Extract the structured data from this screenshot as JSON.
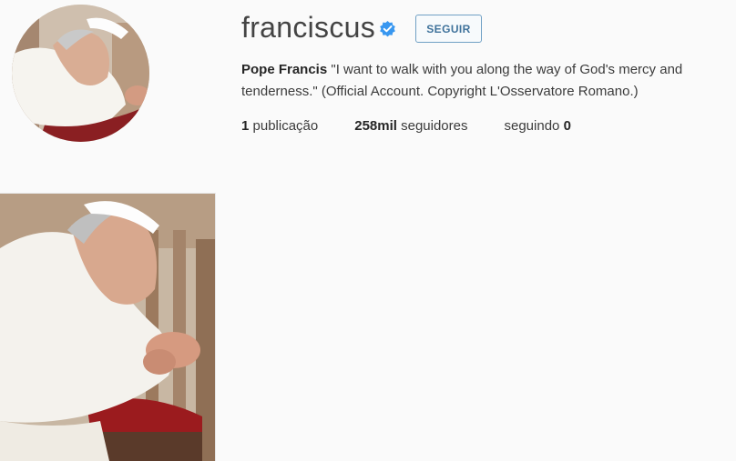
{
  "profile": {
    "username": "franciscus",
    "follow_label": "SEGUIR",
    "bio_name": "Pope Francis",
    "bio_text": " \"I want to walk with you along the way of God's mercy and tenderness.\" (Official Account. Copyright L'Osservatore Romano.)",
    "verified_icon": "verified-badge-icon",
    "avatar_icon": "profile-photo-praying-pope",
    "accent_color": "#3f729b",
    "verified_color": "#3897f0"
  },
  "stats": {
    "posts_count": "1",
    "posts_label": "publicação",
    "followers_count": "258mil",
    "followers_label": "seguidores",
    "following_label": "seguindo",
    "following_count": "0"
  },
  "posts": [
    {
      "icon": "post-photo-praying-pope"
    }
  ]
}
